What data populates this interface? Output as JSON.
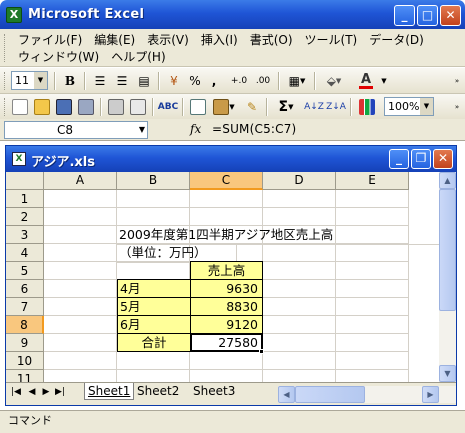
{
  "app": {
    "title": "Microsoft Excel"
  },
  "menu": {
    "row1": [
      "ファイル(F)",
      "編集(E)",
      "表示(V)",
      "挿入(I)",
      "書式(O)",
      "ツール(T)",
      "データ(D)"
    ],
    "row2": [
      "ウィンドウ(W)",
      "ヘルプ(H)"
    ]
  },
  "format_toolbar": {
    "font_size": "11",
    "bold": "B",
    "percent": "%",
    "comma": ",",
    "increase_decimal": "+.0",
    "decrease_decimal": ".00",
    "font_color": "A"
  },
  "standard_toolbar": {
    "sum": "Σ",
    "zoom": "100%"
  },
  "formula_bar": {
    "name_box": "C8",
    "fx": "fx",
    "formula": "=SUM(C5:C7)"
  },
  "workbook": {
    "title": "アジア.xls"
  },
  "columns": [
    "A",
    "B",
    "C",
    "D",
    "E"
  ],
  "rows": [
    "1",
    "2",
    "3",
    "4",
    "5",
    "6",
    "7",
    "8",
    "9",
    "10",
    "11"
  ],
  "cells": {
    "b2": "2009年度第1四半期アジア地区売上高",
    "b3": "（単位：万円）",
    "c4": "売上高",
    "b5": "4月",
    "c5": "9630",
    "b6": "5月",
    "c6": "8830",
    "b7": "6月",
    "c7": "9120",
    "b8": "合計",
    "c8": "27580"
  },
  "sheet_tabs": [
    "Sheet1",
    "Sheet2",
    "Sheet3"
  ],
  "active_sheet": "Sheet1",
  "status": {
    "text": "コマンド"
  },
  "colors": {
    "selection_header": "#f9c77e",
    "cell_fill": "#ffff99",
    "title_bar": "#1f55d6"
  }
}
